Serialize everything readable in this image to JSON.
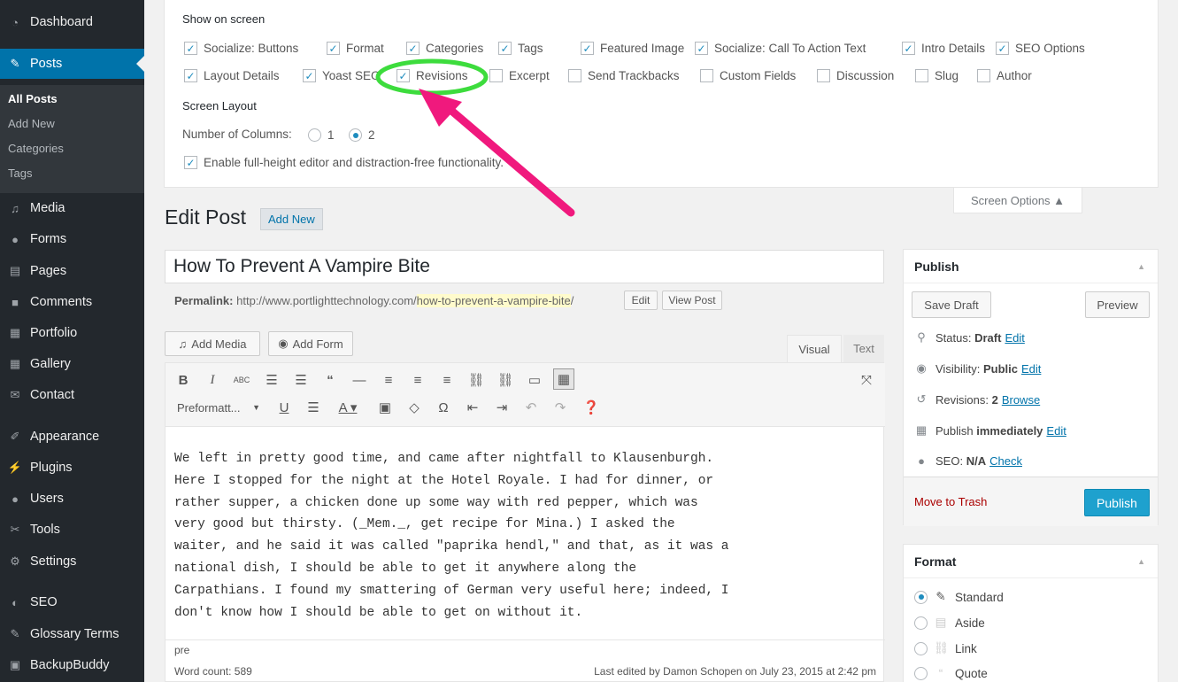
{
  "sidebar": {
    "items": [
      {
        "label": "Dashboard",
        "icon": "dashboard-icon"
      },
      {
        "label": "Posts",
        "icon": "pin-icon"
      },
      {
        "label": "Media",
        "icon": "media-icon"
      },
      {
        "label": "Forms",
        "icon": "forms-icon"
      },
      {
        "label": "Pages",
        "icon": "pages-icon"
      },
      {
        "label": "Comments",
        "icon": "comments-icon"
      },
      {
        "label": "Portfolio",
        "icon": "portfolio-icon"
      },
      {
        "label": "Gallery",
        "icon": "gallery-icon"
      },
      {
        "label": "Contact",
        "icon": "mail-icon"
      },
      {
        "label": "Appearance",
        "icon": "brush-icon"
      },
      {
        "label": "Plugins",
        "icon": "plugin-icon"
      },
      {
        "label": "Users",
        "icon": "users-icon"
      },
      {
        "label": "Tools",
        "icon": "wrench-icon"
      },
      {
        "label": "Settings",
        "icon": "settings-icon"
      },
      {
        "label": "SEO",
        "icon": "seo-icon"
      },
      {
        "label": "Glossary Terms",
        "icon": "pin-icon"
      },
      {
        "label": "BackupBuddy",
        "icon": "backup-icon"
      }
    ],
    "submenu": [
      "All Posts",
      "Add New",
      "Categories",
      "Tags"
    ]
  },
  "screen_options": {
    "show_heading": "Show on screen",
    "boxes": [
      {
        "label": "Socialize: Buttons",
        "checked": true
      },
      {
        "label": "Format",
        "checked": true
      },
      {
        "label": "Categories",
        "checked": true
      },
      {
        "label": "Tags",
        "checked": true
      },
      {
        "label": "Featured Image",
        "checked": true
      },
      {
        "label": "Socialize: Call To Action Text",
        "checked": true
      },
      {
        "label": "Intro Details",
        "checked": true
      },
      {
        "label": "SEO Options",
        "checked": true
      },
      {
        "label": "Layout Details",
        "checked": true
      },
      {
        "label": "Yoast SEO",
        "checked": true
      },
      {
        "label": "Revisions",
        "checked": true
      },
      {
        "label": "Excerpt",
        "checked": false
      },
      {
        "label": "Send Trackbacks",
        "checked": false
      },
      {
        "label": "Custom Fields",
        "checked": false
      },
      {
        "label": "Discussion",
        "checked": false
      },
      {
        "label": "Slug",
        "checked": false
      },
      {
        "label": "Author",
        "checked": false
      }
    ],
    "layout_heading": "Screen Layout",
    "columns_label": "Number of Columns:",
    "col1": "1",
    "col2": "2",
    "fullheight_label": "Enable full-height editor and distraction-free functionality.",
    "tab_label": "Screen Options ▲"
  },
  "page": {
    "title": "Edit Post",
    "add_new": "Add New"
  },
  "post": {
    "title": "How To Prevent A Vampire Bite",
    "permalink_label": "Permalink:",
    "permalink_base": "http://www.portlighttechnology.com/",
    "permalink_slug": "how-to-prevent-a-vampire-bite",
    "permalink_end": "/",
    "edit": "Edit",
    "view": "View Post"
  },
  "editor": {
    "add_media": "Add Media",
    "add_form": "Add Form",
    "tab_visual": "Visual",
    "tab_text": "Text",
    "format_select": "Preformatt...",
    "content": "We left in pretty good time, and came after nightfall to Klausenburgh.\nHere I stopped for the night at the Hotel Royale. I had for dinner, or\nrather supper, a chicken done up some way with red pepper, which was\nvery good but thirsty. (_Mem._, get recipe for Mina.) I asked the\nwaiter, and he said it was called \"paprika hendl,\" and that, as it was a\nnational dish, I should be able to get it anywhere along the\nCarpathians. I found my smattering of German very useful here; indeed, I\ndon't know how I should be able to get on without it.",
    "path": "pre",
    "word_count": "Word count: 589",
    "last_edited": "Last edited by Damon Schopen on July 23, 2015 at 2:42 pm"
  },
  "publish": {
    "heading": "Publish",
    "save_draft": "Save Draft",
    "preview": "Preview",
    "status_label": "Status:",
    "status_value": "Draft",
    "edit": "Edit",
    "visibility_label": "Visibility:",
    "visibility_value": "Public",
    "revisions_label": "Revisions:",
    "revisions_value": "2",
    "browse": "Browse",
    "publish_label": "Publish",
    "publish_value": "immediately",
    "seo_label": "SEO:",
    "seo_value": "N/A",
    "check": "Check",
    "trash": "Move to Trash",
    "publish_btn": "Publish"
  },
  "format": {
    "heading": "Format",
    "options": [
      {
        "label": "Standard",
        "selected": true
      },
      {
        "label": "Aside",
        "selected": false
      },
      {
        "label": "Link",
        "selected": false
      },
      {
        "label": "Quote",
        "selected": false
      }
    ]
  },
  "annotation": {
    "highlight_color": "#3ddc3d",
    "arrow_color": "#f0197d"
  }
}
